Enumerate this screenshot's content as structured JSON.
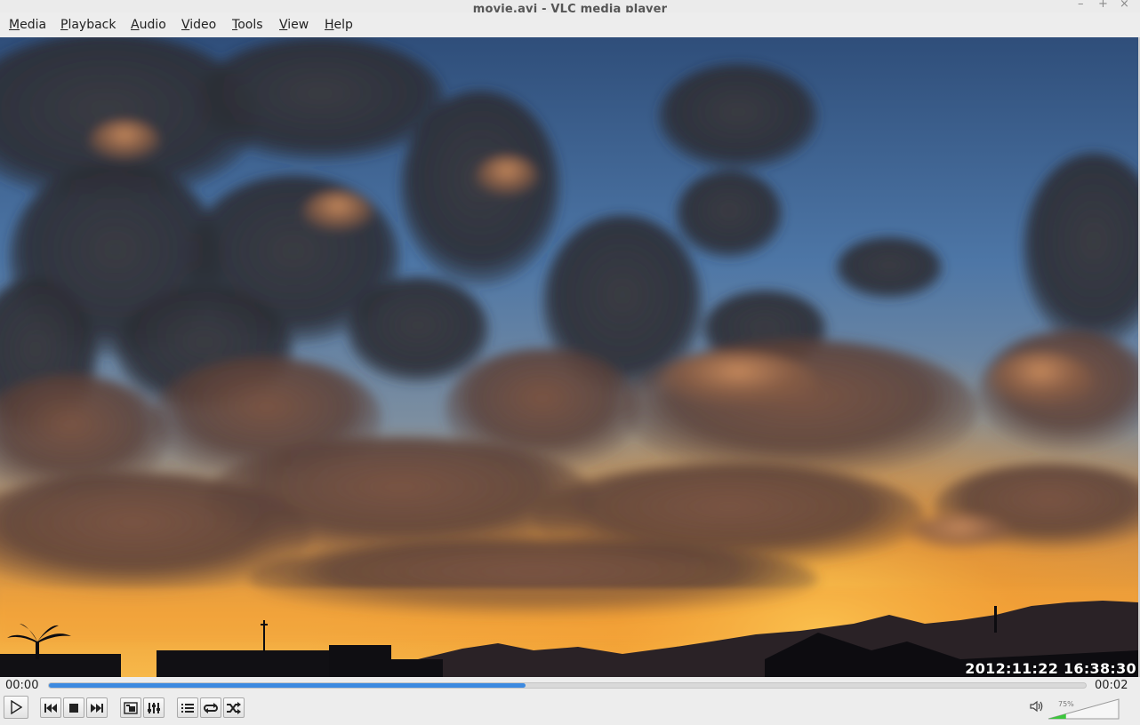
{
  "window": {
    "title": "movie.avi - VLC media player",
    "minimize_glyph": "–",
    "maximize_glyph": "+",
    "close_glyph": "×"
  },
  "menu": {
    "items": [
      {
        "mnemonic": "M",
        "rest": "edia"
      },
      {
        "mnemonic": "P",
        "rest": "layback"
      },
      {
        "mnemonic": "A",
        "rest": "udio"
      },
      {
        "mnemonic": "V",
        "rest": "ideo"
      },
      {
        "mnemonic": "T",
        "rest": "ools"
      },
      {
        "mnemonic": "V",
        "rest": "iew"
      },
      {
        "mnemonic": "H",
        "rest": "elp"
      }
    ]
  },
  "video": {
    "overlay_timestamp": "2012:11:22 16:38:30"
  },
  "seek": {
    "elapsed": "00:00",
    "total": "00:02",
    "progress_fraction": 0.46,
    "fill_color": "#3d8ae0"
  },
  "controls": {
    "icons": [
      "play-icon",
      "previous-icon",
      "stop-icon",
      "next-icon",
      "fullscreen-icon",
      "extended-settings-icon",
      "playlist-icon",
      "loop-icon",
      "shuffle-icon",
      "speaker-icon"
    ]
  },
  "volume": {
    "percent_label": "75%",
    "level_fraction": 0.25,
    "fill_color": "#3cc63c"
  }
}
